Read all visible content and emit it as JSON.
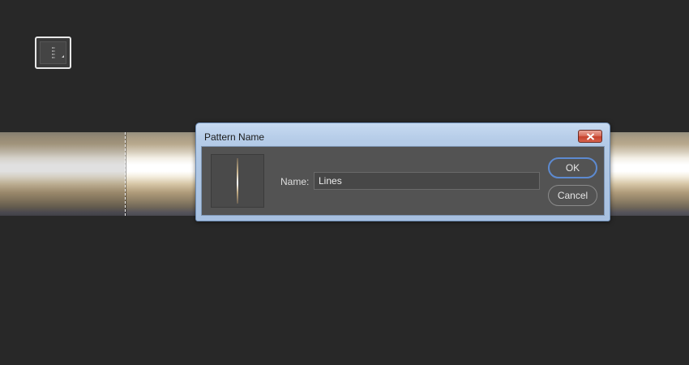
{
  "toolbar": {
    "swatch_icon": "pattern-swatch-icon"
  },
  "dialog": {
    "title": "Pattern Name",
    "close_icon": "close-icon",
    "name_label": "Name:",
    "name_value": "Lines",
    "ok_label": "OK",
    "cancel_label": "Cancel"
  },
  "colors": {
    "background": "#282828",
    "dialog_client": "#535353",
    "title_bar": "#b4cbe7",
    "ok_focus_ring": "#5d8ad0",
    "close_button": "#c6412c"
  }
}
